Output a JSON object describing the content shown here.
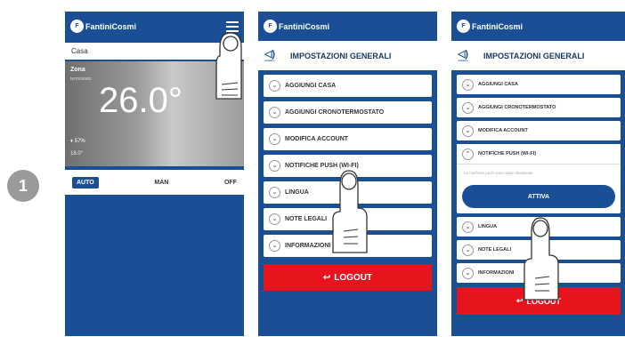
{
  "step_number": "1",
  "brand": {
    "logo": "FantiniCosmi"
  },
  "screen1": {
    "location": "Casa",
    "zone": "Zona",
    "zone_sub": "termostato",
    "temperature": "26.0°",
    "humidity": "57%",
    "setpoint": "18.0°",
    "modes": [
      "AUTO",
      "MAN",
      "OFF"
    ],
    "active_mode": "AUTO"
  },
  "settings": {
    "title": "IMPOSTAZIONI GENERALI",
    "back_label": "indietro",
    "items": [
      "AGGIUNGI CASA",
      "AGGIUNGI CRONOTERMOSTATO",
      "MODIFICA ACCOUNT",
      "NOTIFICHE PUSH (WI-FI)",
      "LINGUA",
      "NOTE LEGALI",
      "INFORMAZIONI"
    ],
    "logout": "LOGOUT"
  },
  "screen3": {
    "notice": "Le notifiche push sono state disattivate",
    "activate_button": "ATTIVA"
  },
  "colors": {
    "primary": "#1a4f96",
    "logout": "#e8141d",
    "step_badge": "#9a9a9a"
  }
}
